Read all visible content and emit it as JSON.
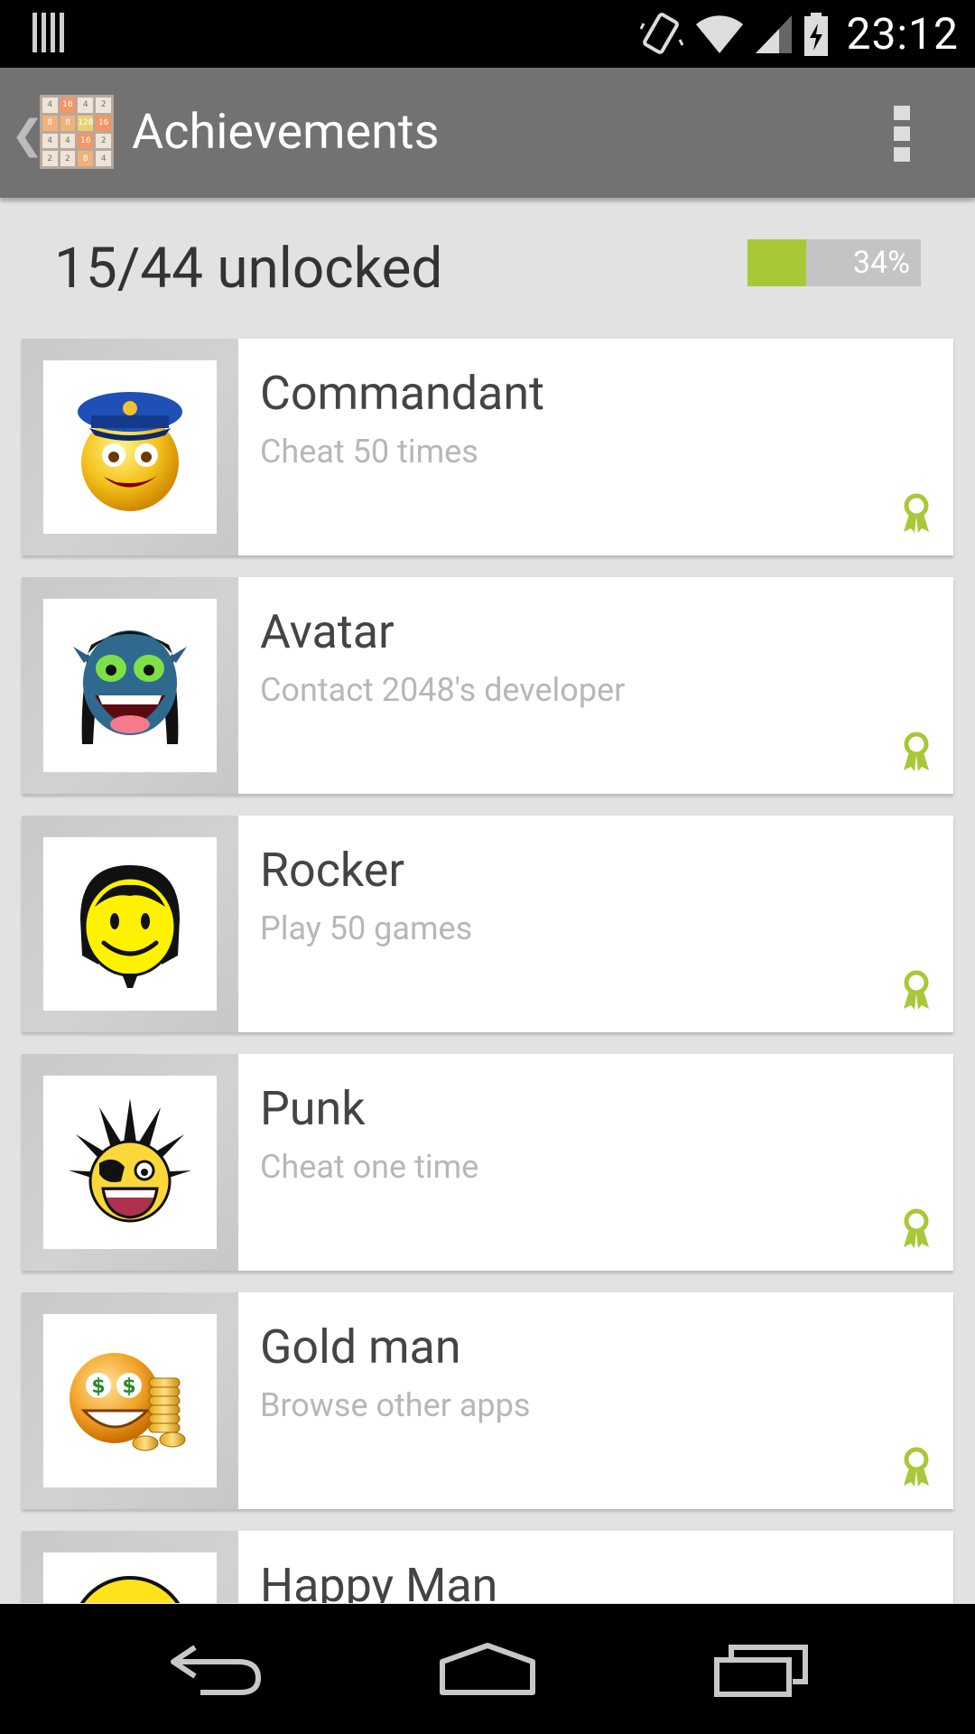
{
  "status_bar": {
    "time": "23:12",
    "icons": [
      "notification-bars-icon",
      "vibrate-icon",
      "wifi-icon",
      "signal-icon",
      "battery-charging-icon"
    ]
  },
  "action_bar": {
    "title": "Achievements",
    "back_icon": "back-caret-icon",
    "menu_icon": "overflow-menu-icon",
    "logo_tiles": [
      "4",
      "16",
      "4",
      "2",
      "8",
      "8",
      "128",
      "16",
      "4",
      "4",
      "16",
      "2",
      "2",
      "2",
      "8",
      "4"
    ]
  },
  "summary": {
    "unlocked_text": "15/44 unlocked",
    "progress_fraction": 0.34,
    "progress_label": "34%",
    "fill_color": "#a8c838"
  },
  "achievements": [
    {
      "title": "Commandant",
      "description": "Cheat 50 times",
      "icon": "police-smiley-icon",
      "unlocked": true
    },
    {
      "title": "Avatar",
      "description": "Contact 2048's developer",
      "icon": "avatar-smiley-icon",
      "unlocked": true
    },
    {
      "title": "Rocker",
      "description": "Play 50 games",
      "icon": "rocker-smiley-icon",
      "unlocked": true
    },
    {
      "title": "Punk",
      "description": "Cheat one time",
      "icon": "punk-smiley-icon",
      "unlocked": true
    },
    {
      "title": "Gold man",
      "description": "Browse other apps",
      "icon": "gold-smiley-icon",
      "unlocked": true
    },
    {
      "title": "Happy Man",
      "description": "",
      "icon": "happy-smiley-icon",
      "unlocked": true
    }
  ],
  "nav_bar": {
    "icons": [
      "back-arrow-icon",
      "home-icon",
      "recent-apps-icon"
    ]
  },
  "colors": {
    "action_bar": "#727272",
    "background": "#e2e2e2",
    "badge": "#a8c838"
  }
}
